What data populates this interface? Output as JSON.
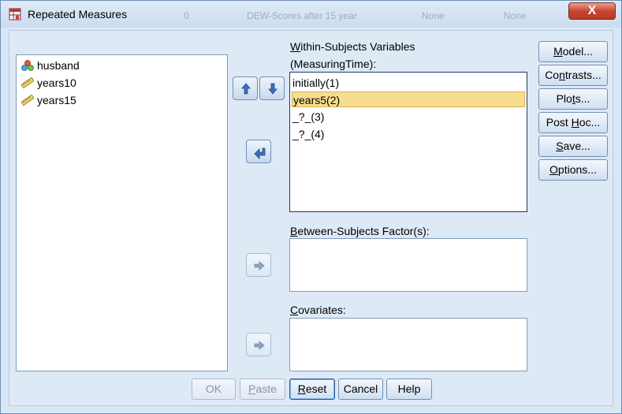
{
  "window": {
    "title": "Repeated Measures",
    "close_label": "X",
    "background_row": [
      "0",
      "DEW-Scores after 15 year",
      "None",
      "None"
    ]
  },
  "variables": [
    {
      "name": "husband",
      "icon": "nominal-icon"
    },
    {
      "name": "years10",
      "icon": "scale-ruler-icon"
    },
    {
      "name": "years15",
      "icon": "scale-ruler-icon"
    }
  ],
  "within": {
    "label_prefix": "W",
    "label_rest": "ithin-Subjects Variables",
    "label_line2": "(MeasuringTime):",
    "items": [
      {
        "text": "initially(1)",
        "selected": false
      },
      {
        "text": "years5(2)",
        "selected": true
      },
      {
        "text": "_?_(3)",
        "selected": false
      },
      {
        "text": "_?_(4)",
        "selected": false
      }
    ]
  },
  "between": {
    "label_prefix": "B",
    "label_rest": "etween-Subjects Factor(s):"
  },
  "covariates": {
    "label_prefix": "C",
    "label_rest": "ovariates:"
  },
  "side_buttons": [
    {
      "pre": "",
      "u": "M",
      "post": "odel..."
    },
    {
      "pre": "Co",
      "u": "n",
      "post": "trasts..."
    },
    {
      "pre": "Plo",
      "u": "t",
      "post": "s..."
    },
    {
      "pre": "Post ",
      "u": "H",
      "post": "oc..."
    },
    {
      "pre": "",
      "u": "S",
      "post": "ave..."
    },
    {
      "pre": "",
      "u": "O",
      "post": "ptions..."
    }
  ],
  "bottom_buttons": {
    "ok": "OK",
    "paste_u": "P",
    "paste_rest": "aste",
    "reset_u": "R",
    "reset_rest": "eset",
    "cancel": "Cancel",
    "help": "Help"
  },
  "colors": {
    "accent": "#3d6fb8",
    "selection": "#f7dd8d",
    "dialog_bg": "#dee9f6",
    "close_red": "#c9452f"
  }
}
